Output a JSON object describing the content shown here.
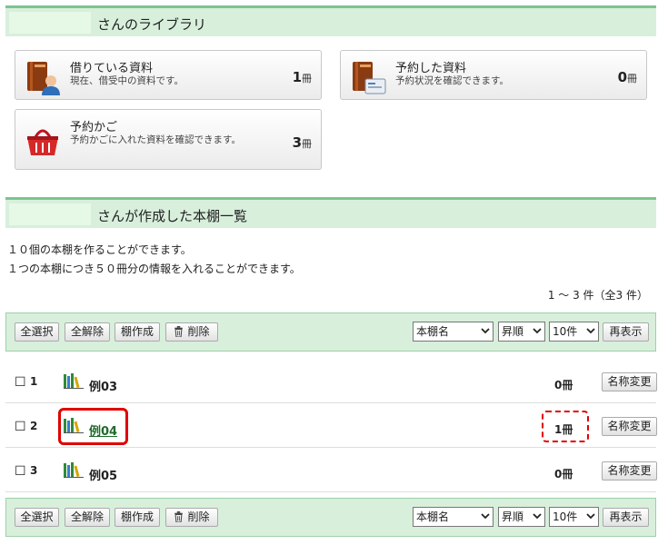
{
  "library_header": {
    "title": "さんのライブラリ"
  },
  "cards": {
    "borrowed": {
      "label": "借りている資料",
      "desc": "現在、借受中の資料です。",
      "count": "1",
      "unit": "冊"
    },
    "reserved": {
      "label": "予約した資料",
      "desc": "予約状況を確認できます。",
      "count": "0",
      "unit": "冊"
    },
    "cart": {
      "label": "予約かご",
      "desc": "予約かごに入れた資料を確認できます。",
      "count": "3",
      "unit": "冊"
    }
  },
  "shelves_header": {
    "title": "さんが作成した本棚一覧"
  },
  "info": {
    "line1": "１０個の本棚を作ることができます。",
    "line2": "１つの本棚につき５０冊分の情報を入れることができます。",
    "range": "1 ～ 3 件（全3 件）"
  },
  "toolbar": {
    "select_all": "全選択",
    "deselect_all": "全解除",
    "create": "棚作成",
    "delete": "削除",
    "sort_field": "本棚名",
    "sort_order": "昇順",
    "per_page": "10件",
    "refresh": "再表示"
  },
  "shelves": [
    {
      "num": "1",
      "name": "例03",
      "count": "0冊",
      "rename": "名称変更"
    },
    {
      "num": "2",
      "name": "例04",
      "count": "1冊",
      "rename": "名称変更"
    },
    {
      "num": "3",
      "name": "例05",
      "count": "0冊",
      "rename": "名称変更"
    }
  ],
  "checkbox_glyph": "☐",
  "colors": {
    "header_bg": "#d8efdc",
    "header_border": "#7cc58e",
    "highlight": "#e00000",
    "link": "#1f6b2a"
  }
}
